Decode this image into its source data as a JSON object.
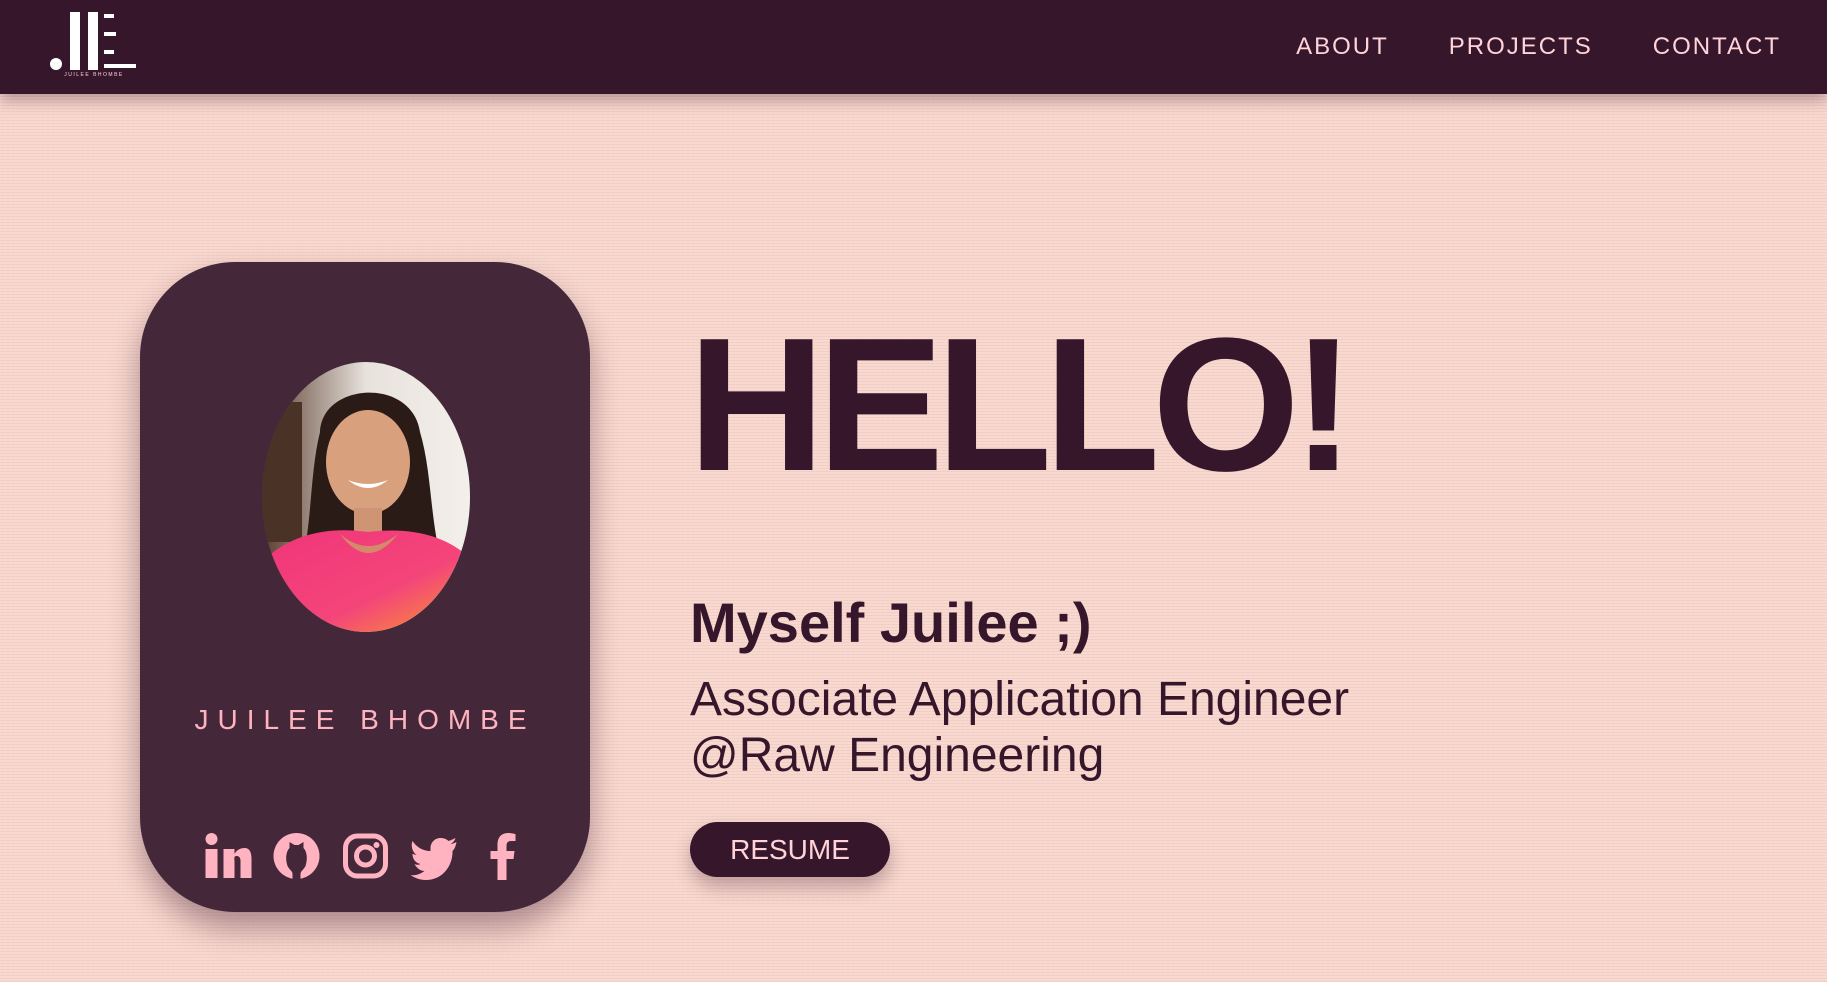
{
  "header": {
    "logo_text": "JUILEE BHOMBE",
    "nav": [
      {
        "label": "ABOUT"
      },
      {
        "label": "PROJECTS"
      },
      {
        "label": "CONTACT"
      }
    ]
  },
  "profile_card": {
    "name": "JUILEE BHOMBE",
    "avatar_alt": "Profile photo",
    "socials": [
      {
        "icon": "linkedin-icon"
      },
      {
        "icon": "github-icon"
      },
      {
        "icon": "instagram-icon"
      },
      {
        "icon": "twitter-icon"
      },
      {
        "icon": "facebook-icon"
      }
    ]
  },
  "hero": {
    "greeting": "HELLO!",
    "intro": "Myself Juilee ;)",
    "role_line1": "Associate Application Engineer",
    "role_line2": "@Raw Engineering",
    "resume_label": "RESUME"
  },
  "colors": {
    "background": "#f9d8cf",
    "primary_dark": "#36162b",
    "card": "#44283a",
    "accent_pink": "#ffb3c0"
  }
}
